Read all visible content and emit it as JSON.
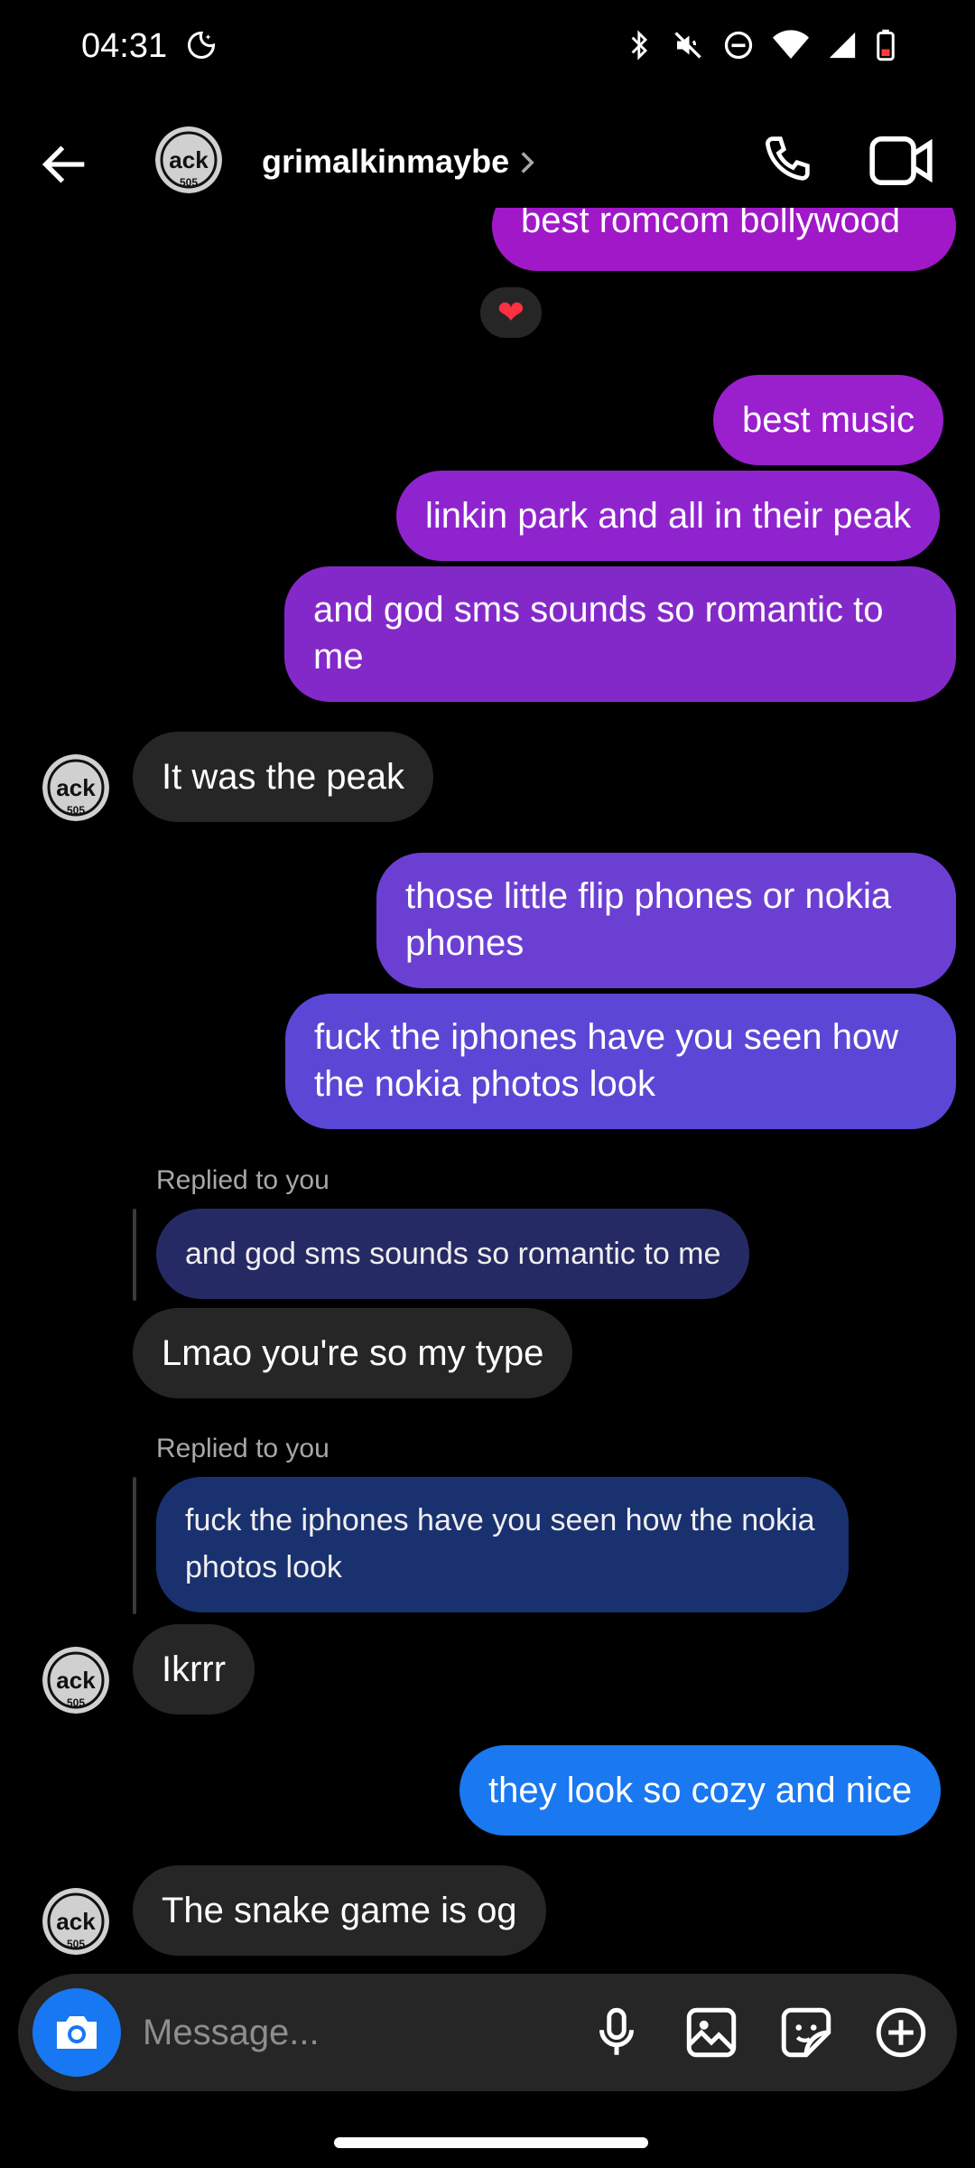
{
  "status": {
    "time": "04:31"
  },
  "header": {
    "username": "grimalkinmaybe"
  },
  "messages": {
    "m1": "best romcom bollywood",
    "reaction": "❤",
    "m2": "best music",
    "m3": "linkin park and all in their peak",
    "m4": "and god sms sounds so romantic to me",
    "m5": "It was the peak",
    "m6": "those little flip phones or nokia phones",
    "m7": "fuck the iphones have you seen how the nokia photos look",
    "reply1_label": "Replied to you",
    "reply1_quote": "and god sms sounds so romantic to me",
    "m8": "Lmao you're so my type",
    "reply2_label": "Replied to you",
    "reply2_quote": "fuck the iphones have you seen how the nokia photos look",
    "m9": "Ikrrr",
    "m10": "they look so cozy and nice",
    "m11": "The snake game is og"
  },
  "composer": {
    "placeholder": "Message..."
  },
  "colors": {
    "bubble_them": "#262626",
    "accent_blue": "#1877f2"
  }
}
